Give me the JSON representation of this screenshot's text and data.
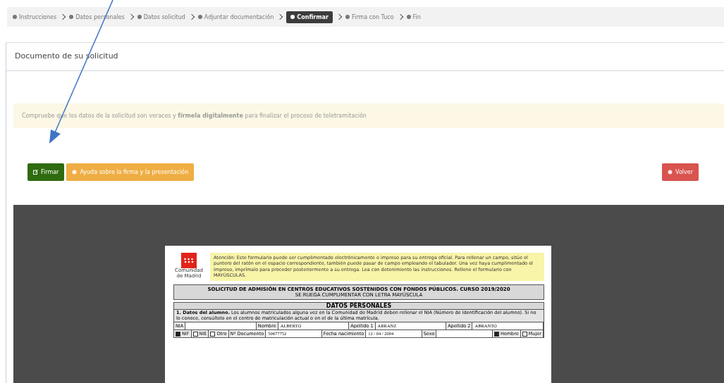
{
  "steps": [
    {
      "label": "Instrucciones",
      "selected": false
    },
    {
      "label": "Datos personales",
      "selected": false
    },
    {
      "label": "Datos solicitud",
      "selected": false
    },
    {
      "label": "Adjuntar documentación",
      "selected": false
    },
    {
      "label": "Confirmar",
      "selected": true
    },
    {
      "label": "Firma con Tuco",
      "selected": false
    },
    {
      "label": "Fin",
      "selected": false
    }
  ],
  "panel": {
    "title": "Documento de su solicitud",
    "alert": "Compruebe que los datos de la solicitud son veraces y **fírmela digitalmente** para finalizar el proceso de teletramitación",
    "buttons": [
      {
        "kind": "sign",
        "label": "Firmar"
      },
      {
        "kind": "help",
        "label": "Ayuda sobre la firma y la presentación"
      },
      {
        "kind": "back",
        "label": "Volver"
      }
    ]
  },
  "document": {
    "notice": "Atención: Este formulario puede ser cumplimentado electrónicamente e impreso para su entrega oficial. Para rellenar un campo, sitúe el puntero del ratón en el espacio correspondiente, también puede pasar de campo empleando el tabulador. Una vez haya cumplimentado el impreso, imprímalo para proceder posteriormente a su entrega. Lea con detenimiento las instrucciones. Rellene el formulario con MAYÚSCULAS.",
    "logo_text": "Comunidad de Madrid",
    "title": "SOLICITUD DE ADMISIÓN EN CENTROS EDUCATIVOS SOSTENIDOS CON FONDOS PÚBLICOS. CURSO 2019/2020",
    "subtitle": "SE RUEGA CUMPLIMENTAR CON LETRA MAYÚSCULA",
    "section": "DATOS PERSONALES",
    "intro": "**1. Datos del alumno.** Los alumnos matriculados alguna vez en la Comunidad de Madrid deben rellenar el NIA (Número de Identificación del alumno). Si no lo conoce, consúltelo en el centro de matriculación actual o en el de la última matrícula.",
    "name_fields": [
      {
        "label": "NIA"
      },
      {
        "label": "Nombre",
        "value": "ALBERTO"
      },
      {
        "label": "Apellido 1",
        "value": "ARRANZ"
      },
      {
        "label": "Apellido 2",
        "value": "ABRANTO"
      }
    ],
    "id_fields": [
      {
        "label": "NIF",
        "checked": true
      },
      {
        "label": "NIE",
        "checked": false
      },
      {
        "label": "Otro",
        "checked": false
      },
      {
        "label": "Nº Documento",
        "value": "50677752"
      },
      {
        "label": "Fecha nacimiento",
        "value": "12 / 04 / 2004"
      },
      {
        "label": "Sexo"
      },
      {
        "label": "Hombre",
        "checked": true
      },
      {
        "label": "Mujer",
        "checked": false
      }
    ]
  }
}
